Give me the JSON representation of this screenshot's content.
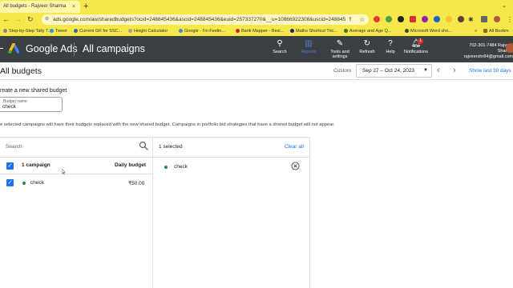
{
  "browser": {
    "tab_title": "All budgets - Rajveer Sharma",
    "tab_close": "×",
    "new_tab": "+",
    "url": "ads.google.com/aw/sharedbudgets?ocid=248845436&ascid=248845436&euid=257337270&__u=10866922308&uscid=248845",
    "bookmarks": [
      {
        "label": "Step-by-Step Tally T...",
        "color": "#888888"
      },
      {
        "label": "Tweet",
        "color": "#1d9bf0"
      },
      {
        "label": "Current GK for SSC...",
        "color": "#2b6cb0"
      },
      {
        "label": "Height Calculator",
        "color": "#9e9e9e"
      },
      {
        "label": "Google - I'm Feelin...",
        "color": "#4285f4"
      },
      {
        "label": "Bank Mapper - Resi...",
        "color": "#c62828"
      },
      {
        "label": "Maths Shortcut Tric...",
        "color": "#1a237e"
      },
      {
        "label": "Average and Age Q...",
        "color": "#2e7d32"
      },
      {
        "label": "Microsoft Word sho...",
        "color": "#37474f"
      }
    ],
    "bookmarks_more": "»",
    "all_bookmarks": "All Bookm"
  },
  "ads_header": {
    "product": "Google Ads",
    "page": "All campaigns",
    "tools": [
      {
        "icon": "search-icon",
        "label": "Search"
      },
      {
        "icon": "bar-chart-icon",
        "label": "Reports"
      },
      {
        "icon": "wrench-icon",
        "label": "Tools and settings"
      },
      {
        "icon": "refresh-icon",
        "label": "Refresh"
      },
      {
        "icon": "help-icon",
        "label": "Help"
      },
      {
        "icon": "bell-icon",
        "label": "Notifications"
      }
    ],
    "notification_badge": "1",
    "account_id": "702-301-7484 Rajveer Sharma",
    "account_email": "rajveershr84@gmail.com"
  },
  "page": {
    "title": "All budgets",
    "date_mode": "Custom",
    "date_range": "Sep 27 – Oct 24, 2023",
    "date_link": "Show last 30 days"
  },
  "form": {
    "create_label": "reate a new shared budget",
    "budget_name_label": "Budget name",
    "budget_name_value": "check",
    "notice": "e selected campaigns will have their budgets replaced with the new shared budget. Campaigns in portfolio bid strategies that have a shared budget will not appear."
  },
  "selector": {
    "search_placeholder": "Search",
    "header_count": "1 campaign",
    "header_budget": "Daily budget",
    "rows": [
      {
        "name": "check",
        "budget": "₹50.00",
        "status_color": "#1e8e3e"
      }
    ],
    "selected_count": "1 selected",
    "clear_all": "Clear all",
    "selected": [
      {
        "name": "check"
      }
    ]
  }
}
